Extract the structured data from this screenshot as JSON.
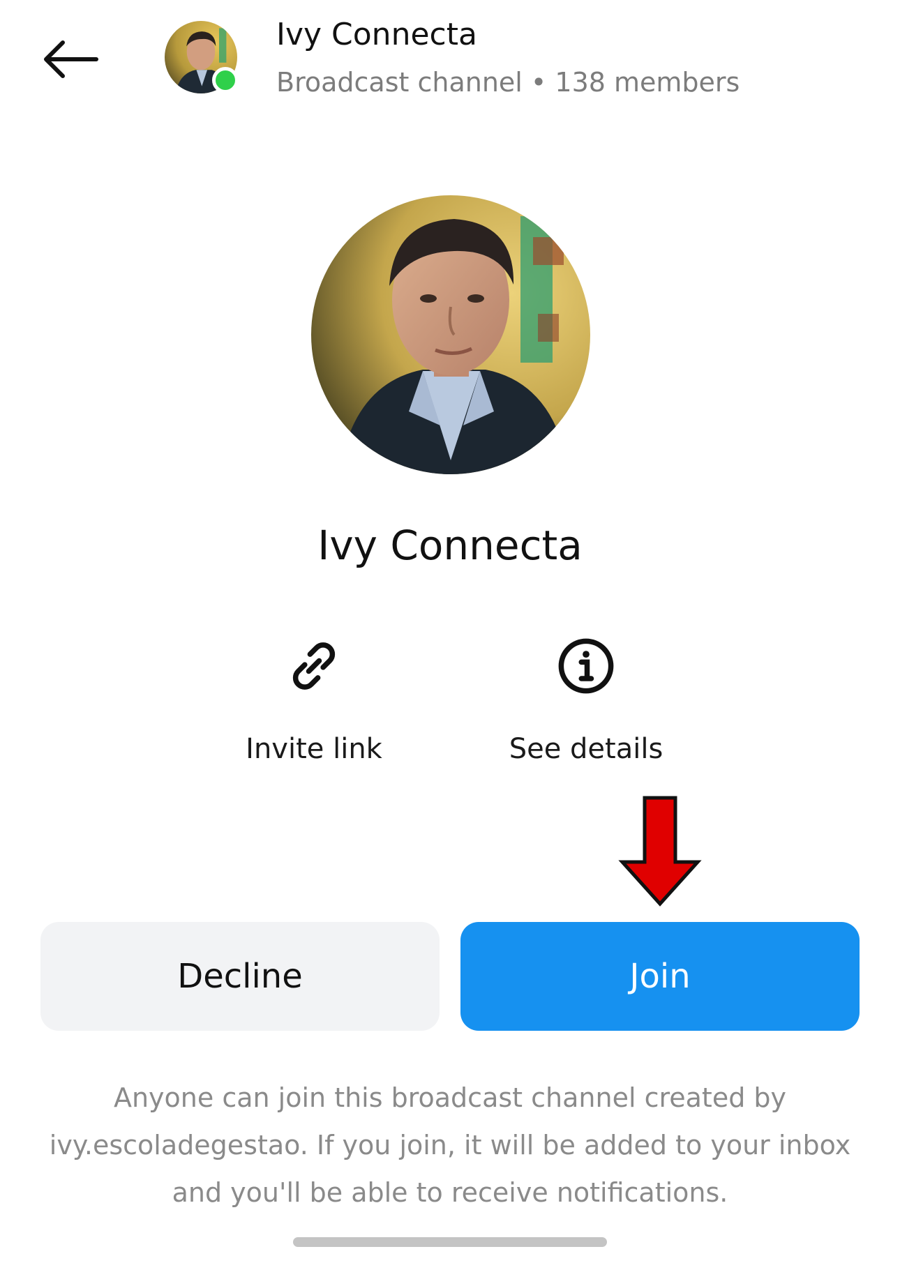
{
  "header": {
    "back_icon": "arrow-left-icon",
    "title": "Ivy Connecta",
    "subtitle": "Broadcast channel • 138 members",
    "online_status_color": "#2fd04a"
  },
  "profile": {
    "channel_name": "Ivy Connecta"
  },
  "actions": [
    {
      "label": "Invite link",
      "icon": "link-icon"
    },
    {
      "label": "See details",
      "icon": "info-icon"
    }
  ],
  "buttons": {
    "decline_label": "Decline",
    "join_label": "Join",
    "join_color": "#1691f0",
    "decline_color": "#f2f3f5"
  },
  "annotation": {
    "icon": "red-down-arrow",
    "color": "#e00000"
  },
  "notice": {
    "text": "Anyone can join this broadcast channel created by ivy.escoladegestao. If you join, it will be added to your inbox and you'll be able to receive notifications."
  }
}
